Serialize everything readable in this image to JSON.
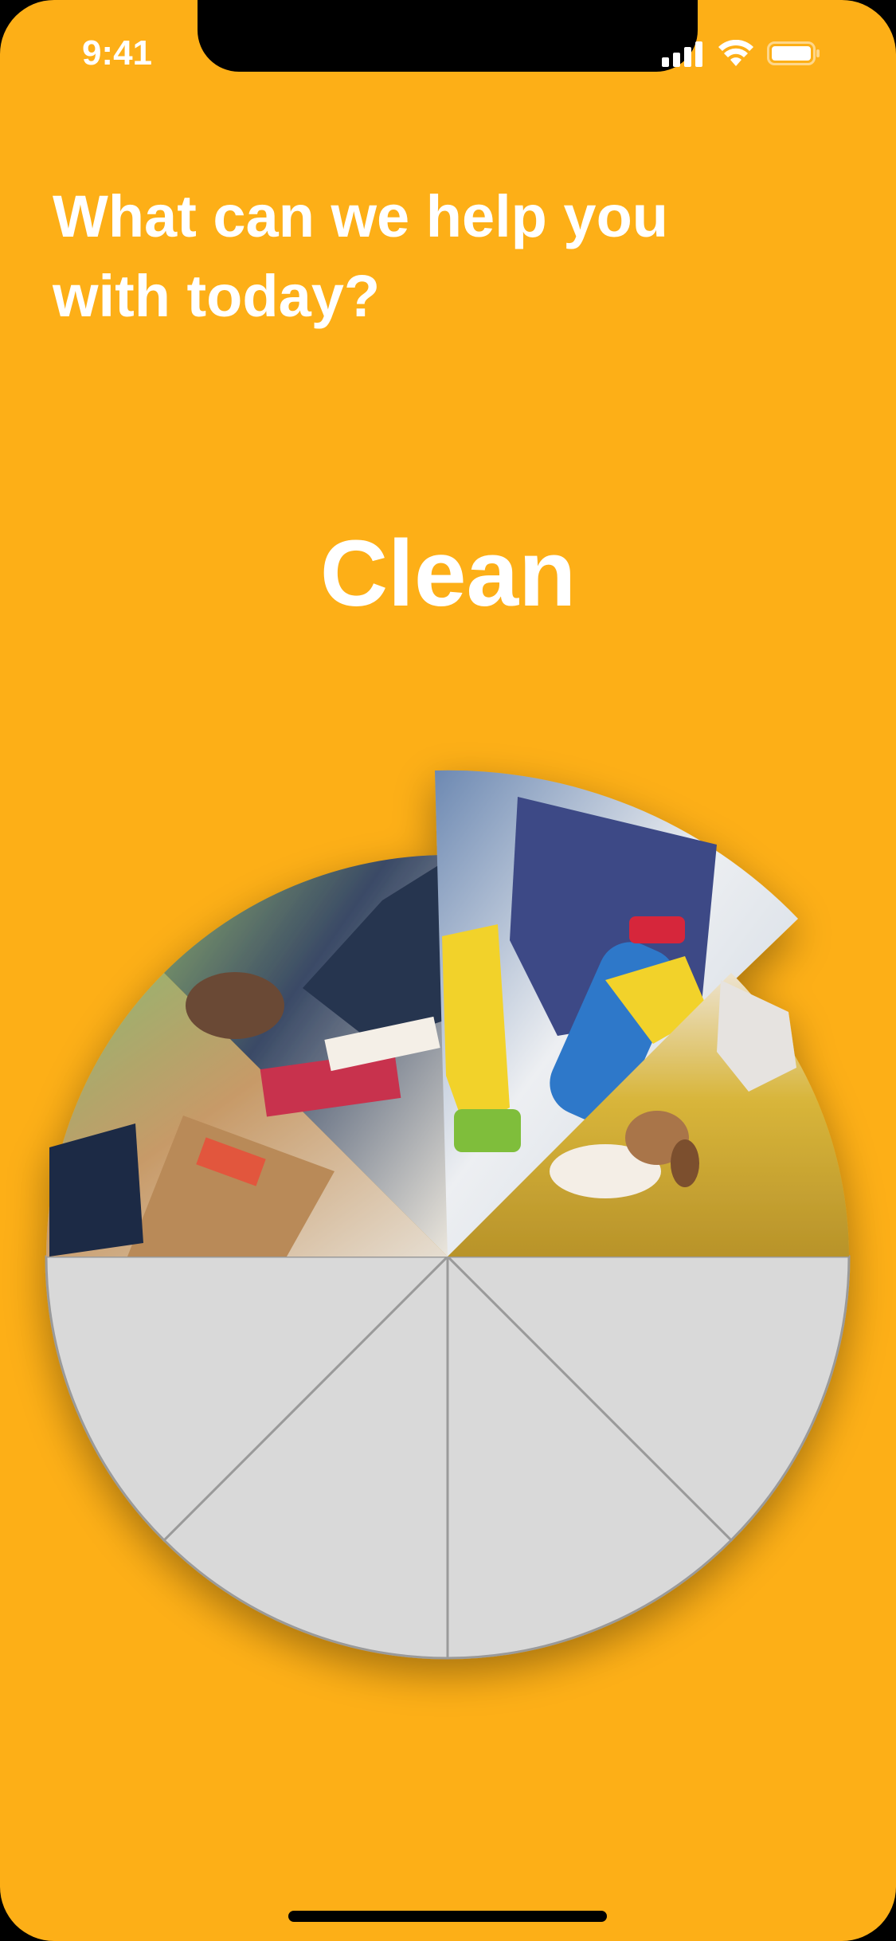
{
  "status_bar": {
    "time": "9:41",
    "icons": [
      "cellular-signal-icon",
      "wifi-icon",
      "battery-icon"
    ]
  },
  "heading": {
    "line1": "What can we help you",
    "line2": "with today?"
  },
  "selected_category": "Clean",
  "wheel": {
    "segments": [
      {
        "name": "wheel-segment-clean",
        "image": "photo: gloved hands cleaning with spray bottle and green sponge",
        "selected": true
      },
      {
        "name": "wheel-segment-pets",
        "image": "photo: beagle on a leash in autumn park",
        "selected": false
      },
      {
        "name": "wheel-segment-tutor",
        "image": "photo: person writing in notebook at desk",
        "selected": false
      },
      {
        "name": "wheel-segment-delivery",
        "image": "photo: cardboard package being handed over",
        "selected": false
      },
      {
        "name": "wheel-segment-empty-1",
        "image": "",
        "selected": false
      },
      {
        "name": "wheel-segment-empty-2",
        "image": "",
        "selected": false
      },
      {
        "name": "wheel-segment-empty-3",
        "image": "",
        "selected": false
      },
      {
        "name": "wheel-segment-empty-4",
        "image": "",
        "selected": false
      }
    ]
  },
  "colors": {
    "background": "#FDAF17",
    "empty_segment": "#D9D9D9",
    "segment_border": "#9A9A9A",
    "text": "#FFFFFF"
  }
}
